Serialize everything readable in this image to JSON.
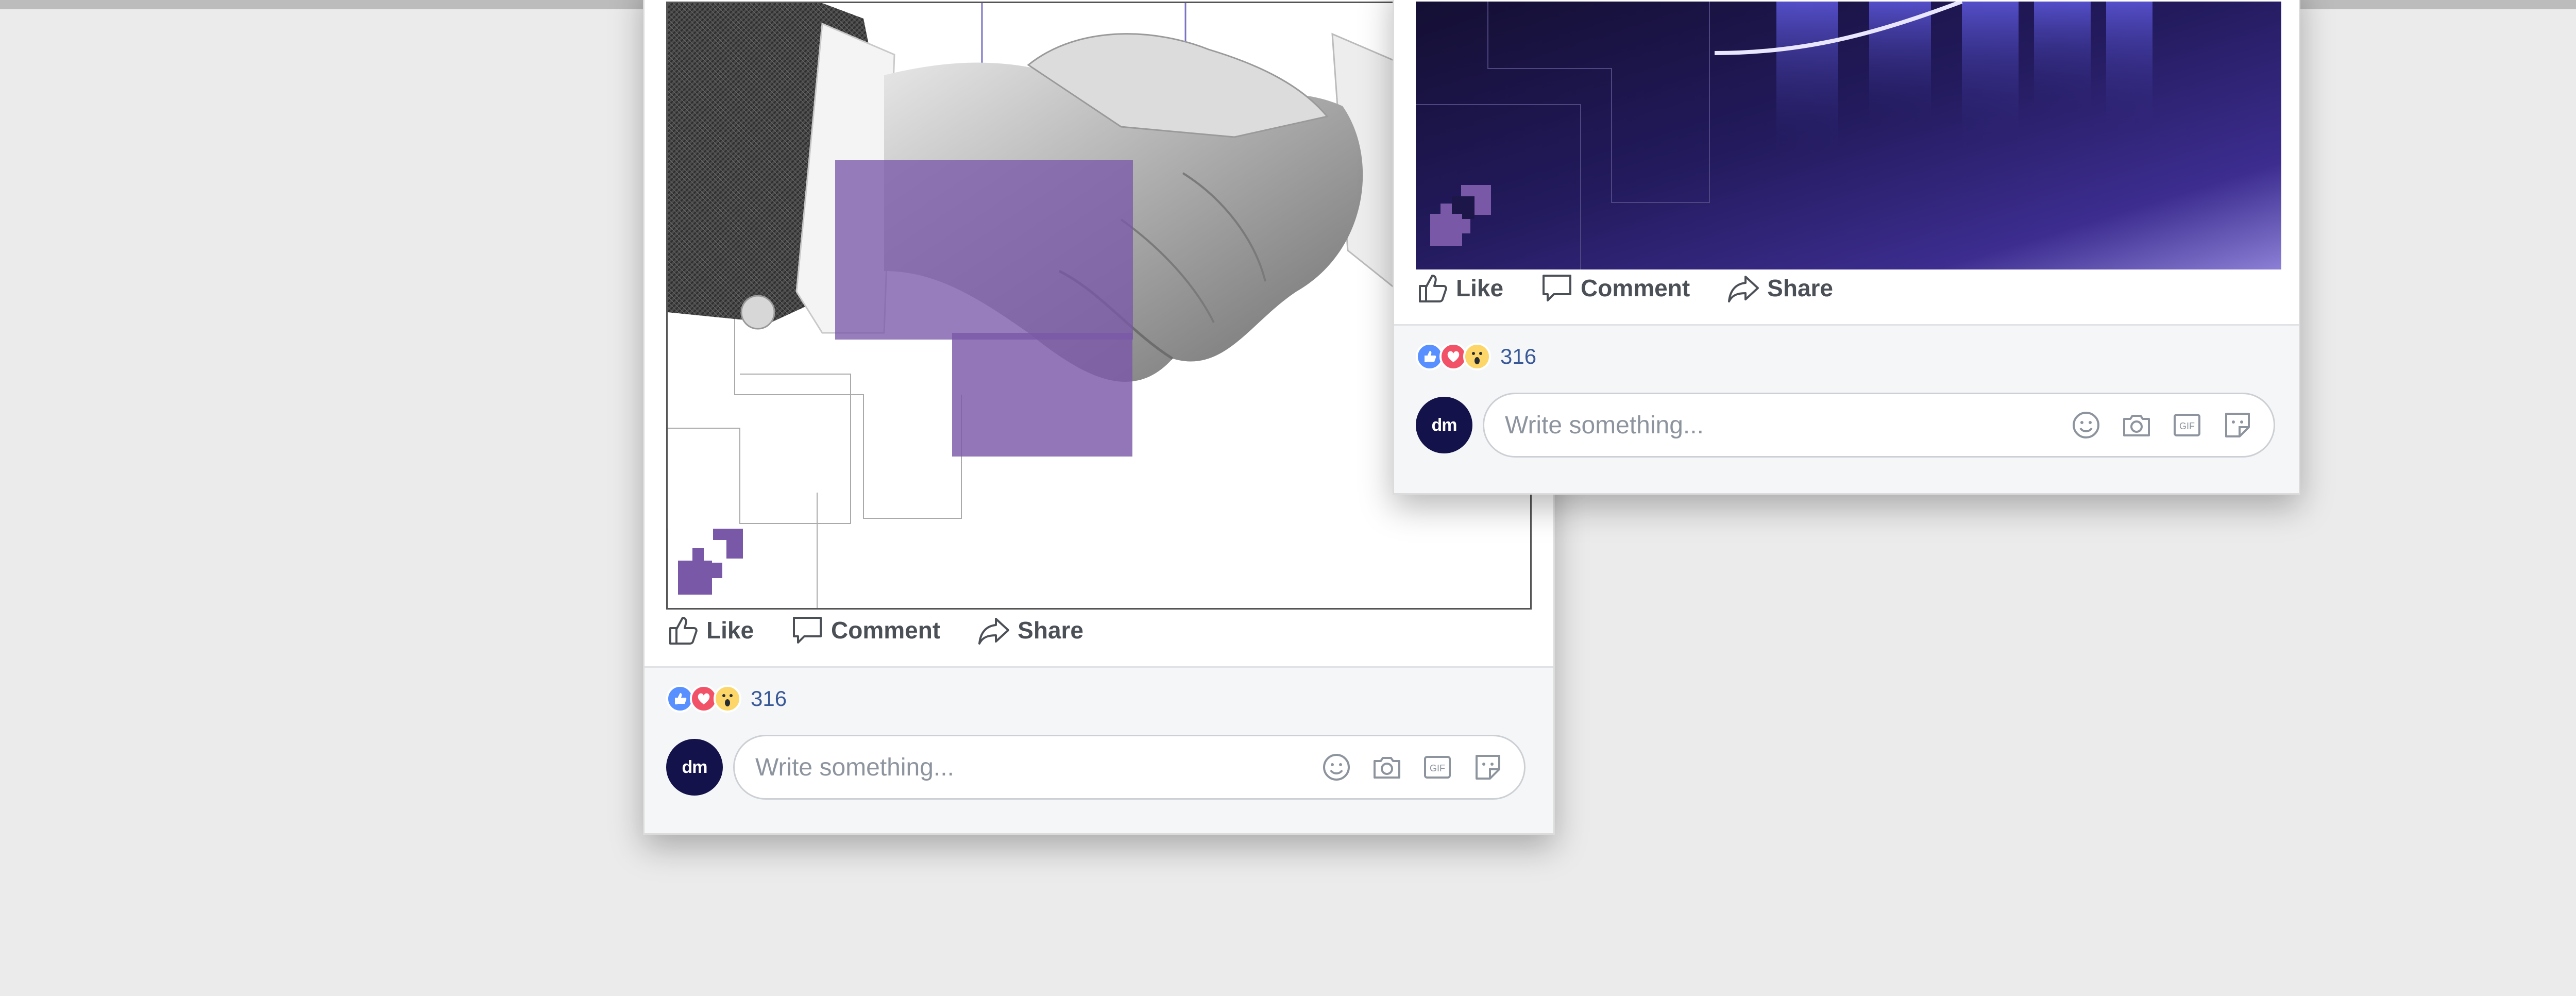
{
  "colors": {
    "background": "#ebebeb",
    "brand_purple": "#7a58a8",
    "reaction_count": "#385898",
    "action_text": "#4b4f56"
  },
  "posts": [
    {
      "actions": [
        {
          "label": "Like",
          "icon": "thumbs-up-icon"
        },
        {
          "label": "Comment",
          "icon": "comment-icon"
        },
        {
          "label": "Share",
          "icon": "share-icon"
        }
      ],
      "reactions": {
        "icons": [
          "like-reaction-icon",
          "love-reaction-icon",
          "wow-reaction-icon"
        ],
        "count": "316"
      },
      "composer": {
        "avatar_text": "dm",
        "placeholder": "Write something...",
        "icons": [
          "emoji-icon",
          "camera-icon",
          "gif-icon",
          "sticker-icon"
        ]
      }
    },
    {
      "actions": [
        {
          "label": "Like",
          "icon": "thumbs-up-icon"
        },
        {
          "label": "Comment",
          "icon": "comment-icon"
        },
        {
          "label": "Share",
          "icon": "share-icon"
        }
      ],
      "reactions": {
        "icons": [
          "like-reaction-icon",
          "love-reaction-icon",
          "wow-reaction-icon"
        ],
        "count": "316"
      },
      "composer": {
        "avatar_text": "dm",
        "placeholder": "Write something...",
        "icons": [
          "emoji-icon",
          "camera-icon",
          "gif-icon",
          "sticker-icon"
        ]
      }
    }
  ]
}
